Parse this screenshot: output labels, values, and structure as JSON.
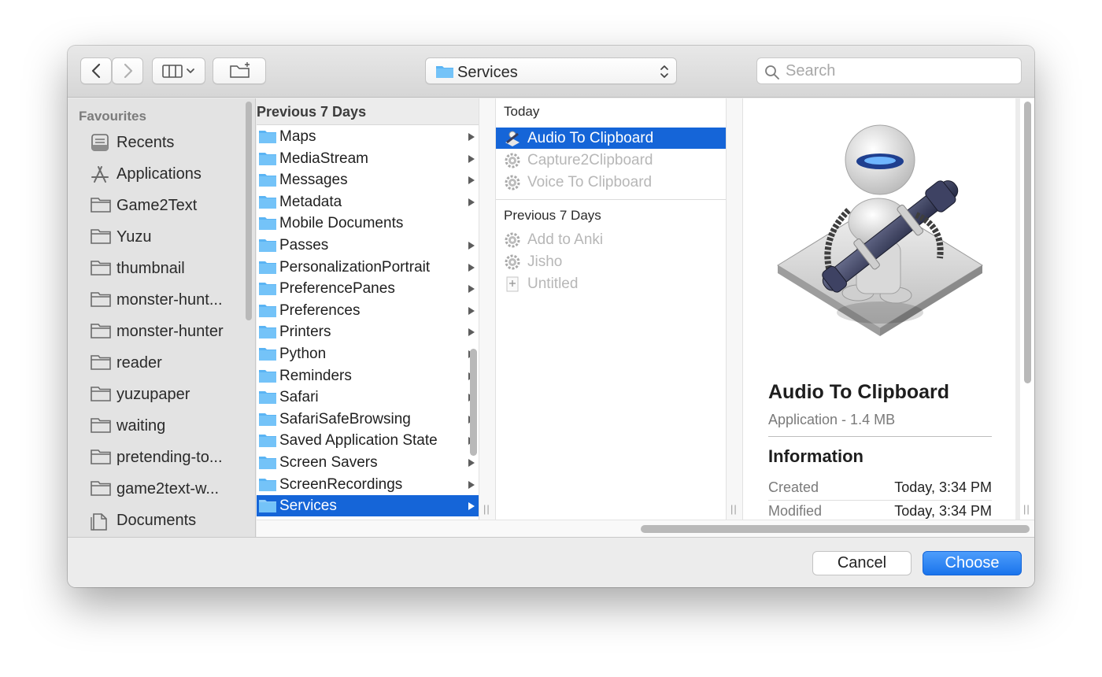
{
  "toolbar": {
    "back_icon": "chevron-left-icon",
    "forward_icon": "chevron-right-icon",
    "view_mode_icon": "column-view-icon",
    "new_folder_icon": "new-folder-icon",
    "path_popup": "Services",
    "search_placeholder": "Search"
  },
  "sidebar": {
    "heading": "Favourites",
    "items": [
      {
        "label": "Recents",
        "icon": "recents-icon"
      },
      {
        "label": "Applications",
        "icon": "applications-icon"
      },
      {
        "label": "Game2Text",
        "icon": "folder-icon"
      },
      {
        "label": "Yuzu",
        "icon": "folder-icon"
      },
      {
        "label": "thumbnail",
        "icon": "folder-icon"
      },
      {
        "label": "monster-hunt...",
        "icon": "folder-icon"
      },
      {
        "label": "monster-hunter",
        "icon": "folder-icon"
      },
      {
        "label": "reader",
        "icon": "folder-icon"
      },
      {
        "label": "yuzupaper",
        "icon": "folder-icon"
      },
      {
        "label": "waiting",
        "icon": "folder-icon"
      },
      {
        "label": "pretending-to...",
        "icon": "folder-icon"
      },
      {
        "label": "game2text-w...",
        "icon": "folder-icon"
      },
      {
        "label": "Documents",
        "icon": "documents-icon"
      }
    ]
  },
  "column1": {
    "header": "Previous 7 Days",
    "items": [
      {
        "label": "Maps",
        "has_children": true
      },
      {
        "label": "MediaStream",
        "has_children": true
      },
      {
        "label": "Messages",
        "has_children": true
      },
      {
        "label": "Metadata",
        "has_children": true
      },
      {
        "label": "Mobile Documents",
        "has_children": false
      },
      {
        "label": "Passes",
        "has_children": true
      },
      {
        "label": "PersonalizationPortrait",
        "has_children": true
      },
      {
        "label": "PreferencePanes",
        "has_children": true
      },
      {
        "label": "Preferences",
        "has_children": true
      },
      {
        "label": "Printers",
        "has_children": true
      },
      {
        "label": "Python",
        "has_children": true
      },
      {
        "label": "Reminders",
        "has_children": true
      },
      {
        "label": "Safari",
        "has_children": true
      },
      {
        "label": "SafariSafeBrowsing",
        "has_children": true
      },
      {
        "label": "Saved Application State",
        "has_children": true
      },
      {
        "label": "Screen Savers",
        "has_children": true
      },
      {
        "label": "ScreenRecordings",
        "has_children": true
      },
      {
        "label": "Services",
        "has_children": true,
        "selected": true
      }
    ]
  },
  "column2": {
    "today_heading": "Today",
    "today_items": [
      {
        "label": "Audio To Clipboard",
        "icon": "automator-robot-icon",
        "selected": true
      },
      {
        "label": "Capture2Clipboard",
        "icon": "gear-icon"
      },
      {
        "label": "Voice To Clipboard",
        "icon": "gear-icon"
      }
    ],
    "previous_heading": "Previous 7 Days",
    "previous_items": [
      {
        "label": "Add to Anki",
        "icon": "gear-icon"
      },
      {
        "label": "Jisho",
        "icon": "gear-icon"
      },
      {
        "label": "Untitled",
        "icon": "plus-document-icon"
      }
    ]
  },
  "preview": {
    "icon": "automator-app-icon",
    "name": "Audio To Clipboard",
    "kind": "Application - 1.4 MB",
    "info_heading": "Information",
    "rows": [
      {
        "key": "Created",
        "value": "Today, 3:34 PM"
      },
      {
        "key": "Modified",
        "value": "Today, 3:34 PM"
      }
    ]
  },
  "buttons": {
    "cancel": "Cancel",
    "choose": "Choose"
  },
  "colors": {
    "selection": "#1565d8",
    "folder": "#5ab4f4",
    "primary_button": "#1a74ec"
  }
}
